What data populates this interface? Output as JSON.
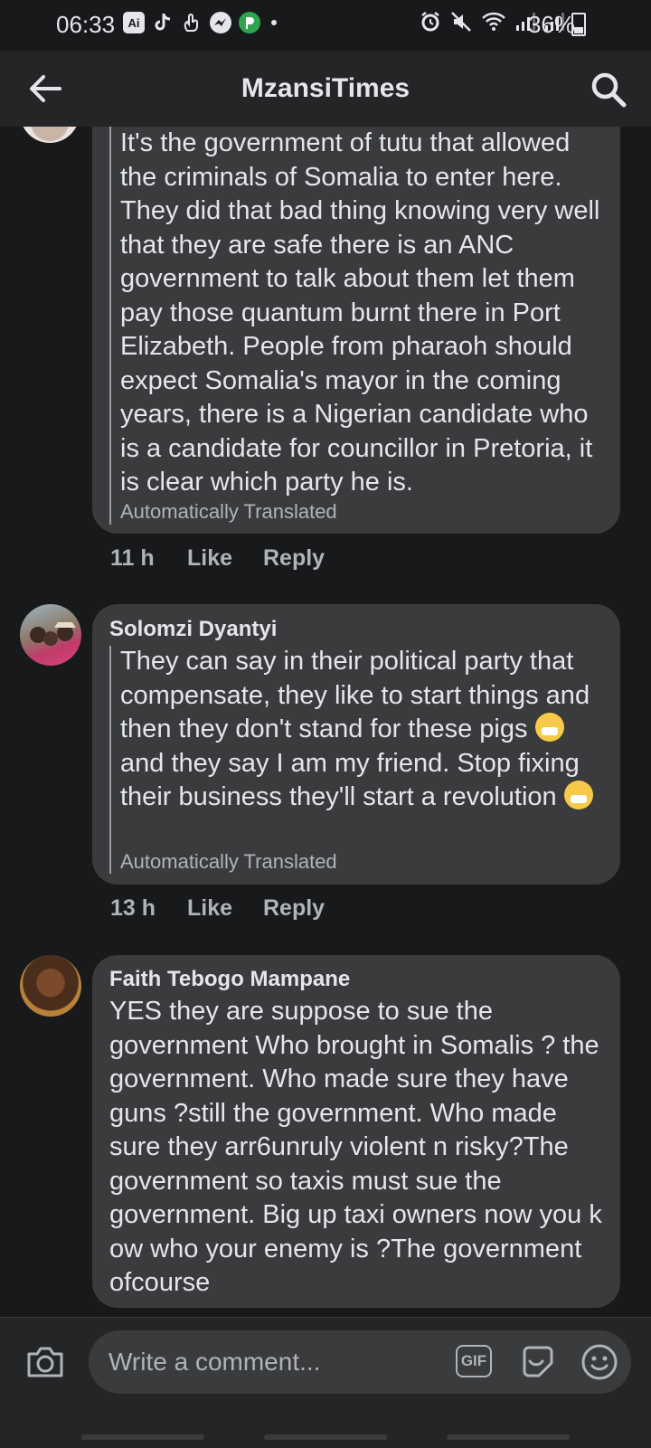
{
  "status_bar": {
    "time": "06:33",
    "app_icons": [
      "Ai",
      "tiktok-icon",
      "hand-icon",
      "messenger-icon",
      "p-app-icon"
    ],
    "battery": "36%"
  },
  "header": {
    "title": "MzansiTimes"
  },
  "comments": [
    {
      "author": "",
      "text": "It's the government of tutu that allowed the criminals of Somalia to enter here. They did that bad thing knowing very well that they are safe there is an ANC government to talk about them let them pay those quantum burnt there in Port Elizabeth. People from pharaoh should expect Somalia's mayor in the coming years, there is a Nigerian candidate who is a candidate for councillor in Pretoria, it is clear which party he is.",
      "translated_label": "Automatically Translated",
      "time": "11 h",
      "like_label": "Like",
      "reply_label": "Reply"
    },
    {
      "author": "Solomzi Dyantyi",
      "text_1": "They can say in their political party that compensate, they like to start things and then they don't stand for these pigs",
      "text_2": " and they say I am my friend. Stop fixing their business they'll start a revolution ",
      "translated_label": "Automatically Translated",
      "time": "13 h",
      "like_label": "Like",
      "reply_label": "Reply"
    },
    {
      "author": "Faith Tebogo Mampane",
      "text": "YES they are suppose to sue the government  Who brought in Somalis ? the government. Who made sure they have guns ?still the government. Who made sure they arr6unruly violent n risky?The government so taxis must sue the government. Big up taxi owners now you k ow who your enemy is ?The government ofcourse"
    }
  ],
  "composer": {
    "placeholder": "Write a comment...",
    "gif_label": "GIF"
  },
  "colors": {
    "background": "#18191a",
    "header": "#242526",
    "bubble": "#3a3b3c",
    "text": "#e4e6eb",
    "muted": "#b0b3b8"
  }
}
